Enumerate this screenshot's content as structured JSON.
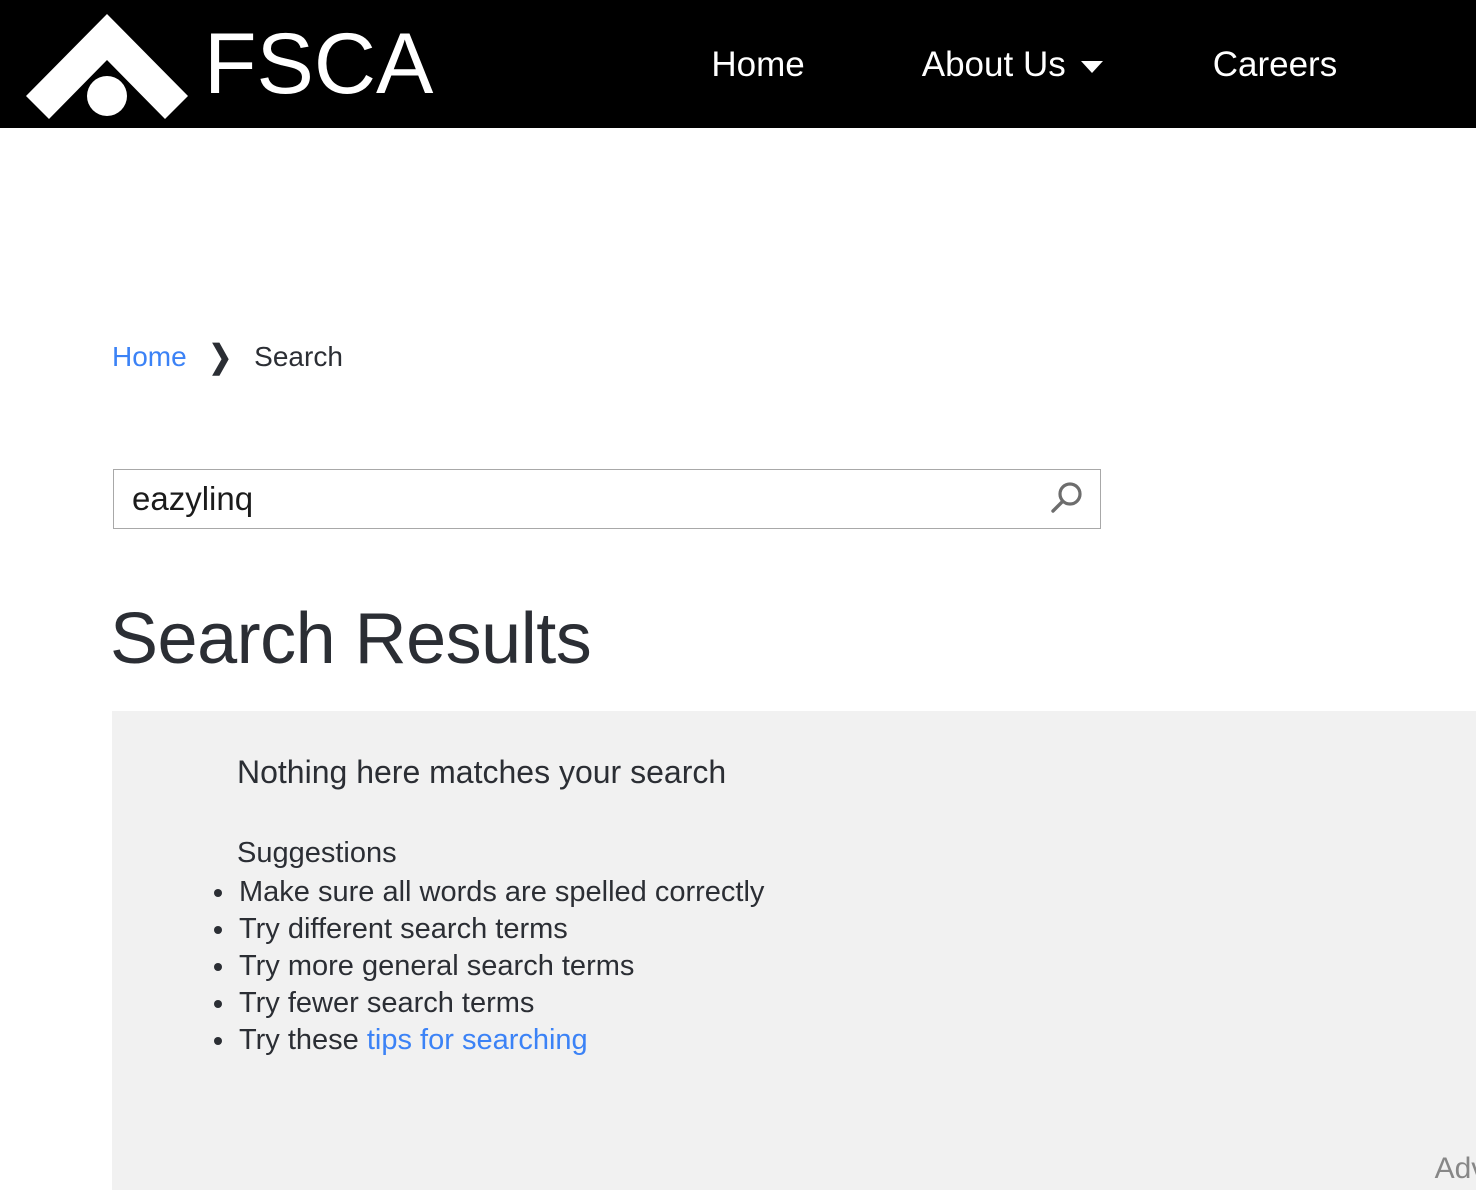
{
  "header": {
    "logo": {
      "icon": "fsca-chevron-logo-icon",
      "text": "FSCA"
    },
    "nav": [
      {
        "label": "Home",
        "has_dropdown": false
      },
      {
        "label": "About Us",
        "has_dropdown": true
      },
      {
        "label": "Careers",
        "has_dropdown": false
      }
    ],
    "background_color": "#000000",
    "text_color": "#ffffff"
  },
  "breadcrumb": {
    "home_label": "Home",
    "separator": "❯",
    "current_label": "Search"
  },
  "search": {
    "value": "eazylinq",
    "placeholder": "",
    "icon": "search-icon"
  },
  "main": {
    "title": "Search Results",
    "no_results_message": "Nothing here matches your search",
    "suggestions_label": "Suggestions",
    "suggestions": [
      {
        "text": "Make sure all words are spelled correctly",
        "link_text": "",
        "link": false
      },
      {
        "text": "Try different search terms",
        "link_text": "",
        "link": false
      },
      {
        "text": "Try more general search terms",
        "link_text": "",
        "link": false
      },
      {
        "text": "Try fewer search terms",
        "link_text": "",
        "link": false
      },
      {
        "text": "Try these ",
        "link_text": "tips for searching",
        "link": true
      }
    ],
    "advanced_label": "Advanced"
  },
  "colors": {
    "link_blue": "#3b82f6",
    "text_dark": "#2b2e34",
    "panel_gray": "#f1f1f1",
    "muted_gray": "#878787",
    "border_gray": "#a8a8a8"
  }
}
